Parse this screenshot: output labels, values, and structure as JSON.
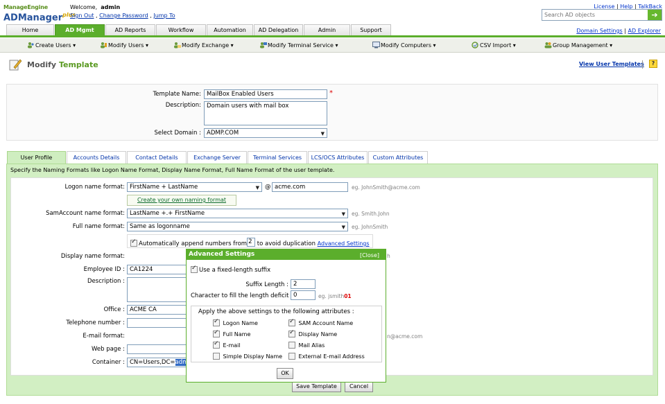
{
  "brand": {
    "line1": "ManageEngine",
    "line2": "ADManager",
    "plus": "plus"
  },
  "welcome": {
    "prefix": "Welcome,",
    "user": "admin"
  },
  "top_links": {
    "sign_out": "Sign Out",
    "change_password": "Change Password",
    "jump_to": "Jump To",
    "sep": " , "
  },
  "right_links": {
    "license": "License",
    "help": "Help",
    "talkback": "TalkBack",
    "sep": " | "
  },
  "search": {
    "placeholder": "Search AD objects",
    "go": "➔"
  },
  "tabs": [
    {
      "label": "Home"
    },
    {
      "label": "AD Mgmt"
    },
    {
      "label": "AD Reports"
    },
    {
      "label": "Workflow"
    },
    {
      "label": "Automation"
    },
    {
      "label": "AD Delegation"
    },
    {
      "label": "Admin"
    },
    {
      "label": "Support"
    }
  ],
  "domain_links": {
    "settings": "Domain Settings",
    "explorer": "AD Explorer",
    "sep": " | "
  },
  "submenu": [
    {
      "label": "Create Users ▾"
    },
    {
      "label": "Modify Users ▾"
    },
    {
      "label": "Modify Exchange ▾"
    },
    {
      "label": "Modify Terminal Service ▾"
    },
    {
      "label": "Modify Computers ▾"
    },
    {
      "label": "CSV Import ▾"
    },
    {
      "label": "Group Management ▾"
    }
  ],
  "page": {
    "title_a": "Modify",
    "title_b": " Template",
    "view_templates": "View User Templates",
    "help": "?"
  },
  "template": {
    "name_label": "Template Name:",
    "name_value": "MailBox Enabled Users",
    "required": "*",
    "desc_label": "Description:",
    "desc_value": "Domain users with mail box",
    "domain_label": "Select Domain :",
    "domain_value": "ADMP.COM"
  },
  "subtabs": [
    {
      "label": "User Profile"
    },
    {
      "label": "Accounts Details"
    },
    {
      "label": "Contact Details"
    },
    {
      "label": "Exchange Server"
    },
    {
      "label": "Terminal Services"
    },
    {
      "label": "LCS/OCS Attributes"
    },
    {
      "label": "Custom Attributes"
    }
  ],
  "panel_desc": "Specify the Naming Formats like Logon Name Format, Display Name Format, Full Name Format of the user template.",
  "form": {
    "logon_label": "Logon name format:",
    "logon_value": "FirstName + LastName",
    "at": "@",
    "domain_value": "acme.com",
    "logon_hint": "eg. JohnSmith@acme.com",
    "create_format": "Create your own naming format",
    "sam_label": "SamAccount name format:",
    "sam_value": "LastName +.+ FirstName",
    "sam_hint": "eg. Smith.John",
    "full_label": "Full name format:",
    "full_value": "Same as logonname",
    "full_hint": "eg. JohnSmith",
    "append_label_a": "Automatically append numbers from",
    "append_value": "2",
    "append_label_b": "to avoid duplication",
    "advanced_link": "Advanced Settings",
    "display_label": "Display name format:",
    "display_hint_frag": "h",
    "employee_label": "Employee ID :",
    "employee_value": "CA1224",
    "description_label": "Description :",
    "office_label": "Office :",
    "office_value": "ACME CA",
    "phone_label": "Telephone number :",
    "email_label": "E-mail format:",
    "email_hint_frag": "n@acme.com",
    "web_label": "Web page :",
    "container_label": "Container :",
    "container_value": "CN=Users,DC=",
    "container_sel": "adm"
  },
  "advanced": {
    "title": "Advanced Settings",
    "close": "[Close]",
    "fixed_suffix": "Use a fixed-length suffix",
    "suffix_len_label": "Suffix Length :",
    "suffix_len_value": "2",
    "fill_label": "Character to fill the length deficit :",
    "fill_value": "0",
    "fill_hint": "eg. jsmith",
    "fill_hint_red": "01",
    "apply_label": "Apply the above settings to the following attributes :",
    "attrs": [
      {
        "label": "Logon Name",
        "checked": true
      },
      {
        "label": "SAM Account Name",
        "checked": true
      },
      {
        "label": "Full Name",
        "checked": true
      },
      {
        "label": "Display Name",
        "checked": true
      },
      {
        "label": "E-mail",
        "checked": true
      },
      {
        "label": "Mail Alias",
        "checked": false
      },
      {
        "label": "Simple Display Name",
        "checked": false
      },
      {
        "label": "External E-mail Address",
        "checked": false
      }
    ],
    "ok": "OK"
  },
  "buttons": {
    "save": "Save Template",
    "cancel": "Cancel"
  },
  "colors": {
    "accent": "#5bae2c",
    "link": "#0033aa",
    "panel": "#d2efc3"
  }
}
